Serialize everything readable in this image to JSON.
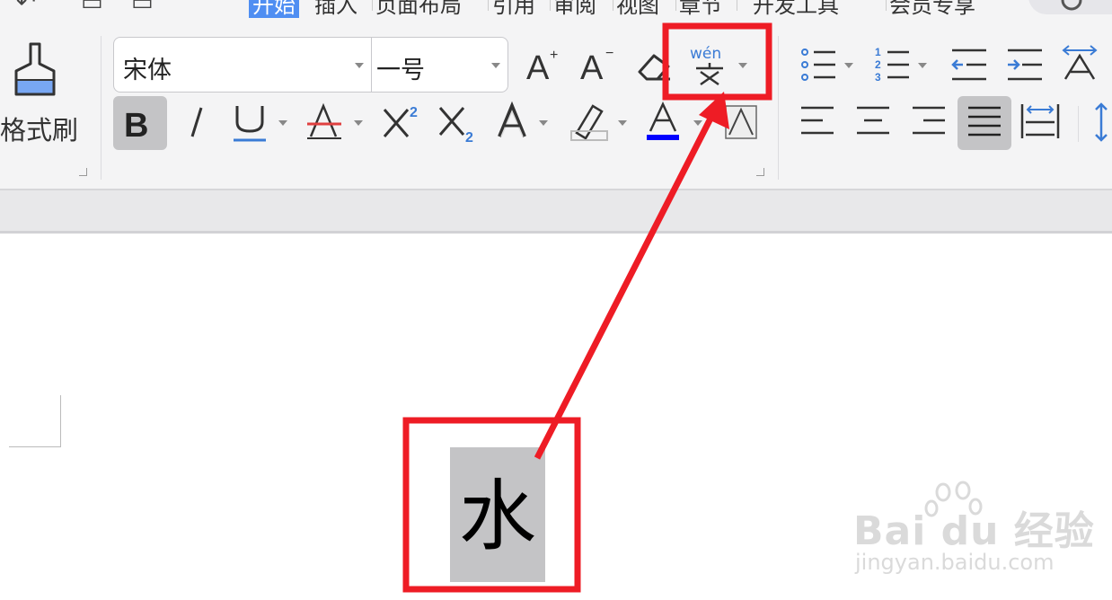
{
  "menu": {
    "tabs": [
      {
        "label": "开始",
        "active": true
      },
      {
        "label": "插入"
      },
      {
        "label": "页面布局"
      },
      {
        "label": "引用"
      },
      {
        "label": "审阅"
      },
      {
        "label": "视图"
      },
      {
        "label": "章节"
      },
      {
        "label": "开发工具"
      },
      {
        "label": "会员专享"
      }
    ]
  },
  "ribbon": {
    "format_painter_label": "格式刷",
    "font_name": "宋体",
    "font_size": "一号",
    "pinyin_label": "wén"
  },
  "document": {
    "selected_char": "水"
  },
  "watermark": {
    "brand": "Bai du 经验",
    "url": "jingyan.baidu.com"
  },
  "colors": {
    "accent": "#4f8ef2",
    "annotation": "#ee1c25",
    "selection": "#c4c4c6",
    "underline_blue": "#3a7bd5",
    "strike_red": "#e04040",
    "font_color_bar": "#0000ff"
  }
}
